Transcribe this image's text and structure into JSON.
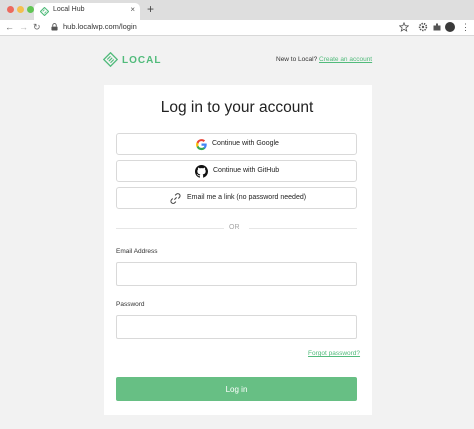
{
  "browser": {
    "tab_title": "Local Hub",
    "tab_close": "×",
    "new_tab": "+",
    "url": "hub.localwp.com/login",
    "icons": [
      "back-icon",
      "forward-icon",
      "reload-icon",
      "lock-icon",
      "star-icon",
      "settings-icon",
      "extensions-icon",
      "avatar",
      "menu-icon"
    ]
  },
  "header": {
    "brand": "LOCAL",
    "prompt": "New to Local?",
    "create_account": "Create an account"
  },
  "login": {
    "title": "Log in to your account",
    "google_label": "Continue with Google",
    "github_label": "Continue with GitHub",
    "email_link_label": "Email me a link (no password needed)",
    "divider": "OR",
    "email_label": "Email Address",
    "email_value": "",
    "password_label": "Password",
    "password_value": "",
    "forgot_password": "Forgot password?",
    "submit": "Log in"
  },
  "colors": {
    "accent": "#51bb7b",
    "button": "#67bf84",
    "background": "#f2f2f2"
  }
}
